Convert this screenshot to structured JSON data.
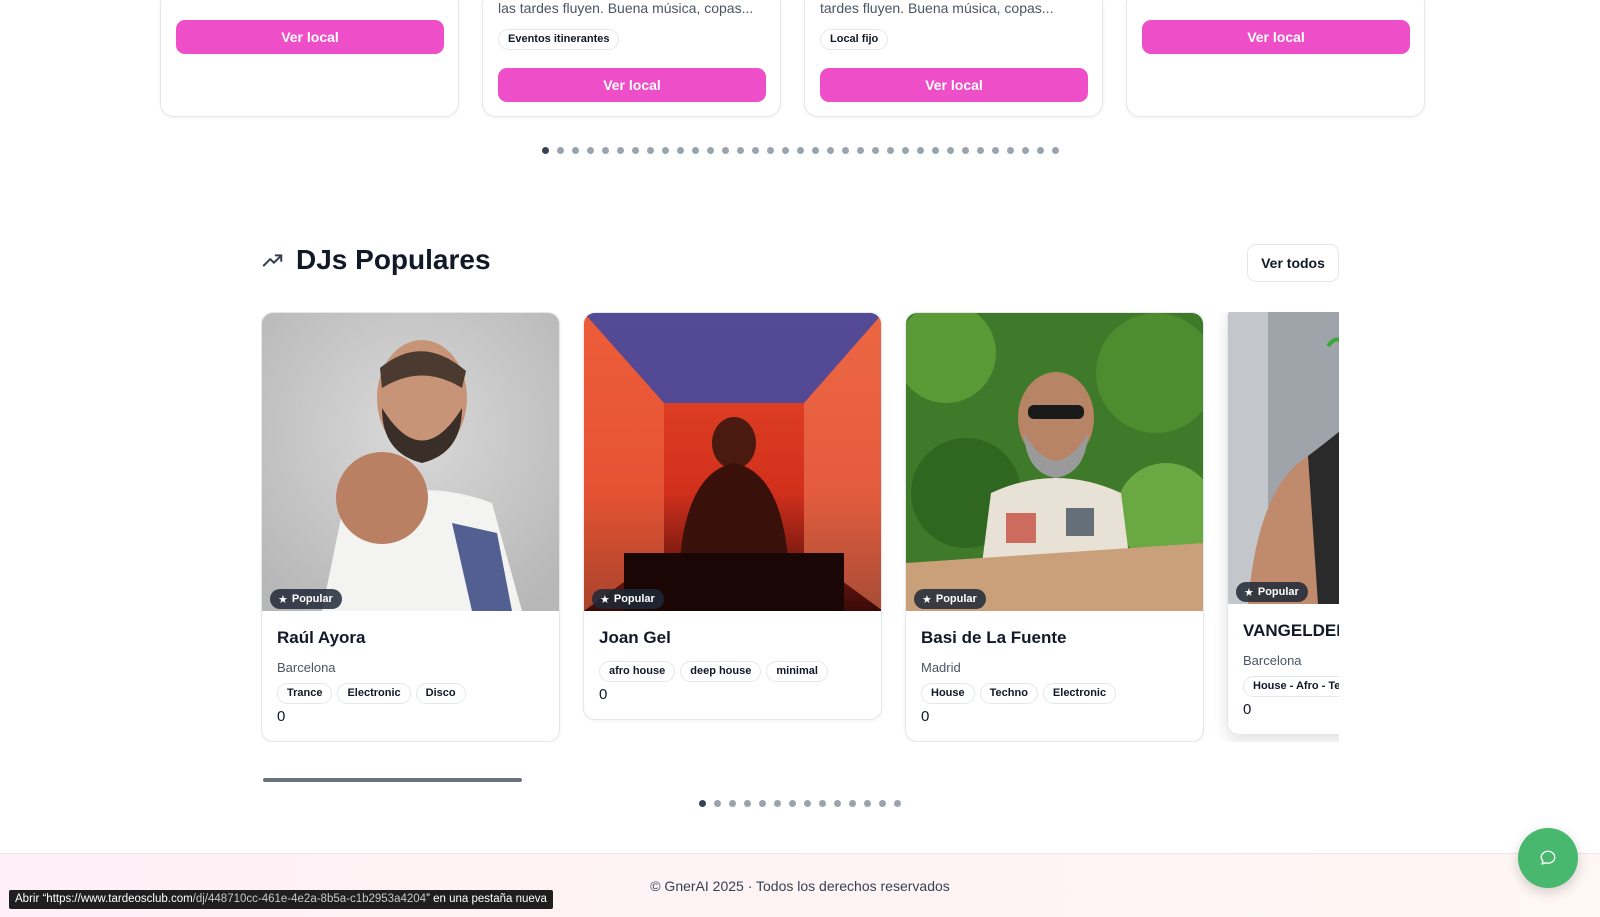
{
  "venues": {
    "cards": [
      {
        "description": "",
        "tag": "",
        "button_label": "Ver local"
      },
      {
        "description": "las tardes fluyen. Buena música, copas...",
        "tag": "Eventos itinerantes",
        "button_label": "Ver local"
      },
      {
        "description": "tardes fluyen. Buena música, copas...",
        "tag": "Local fijo",
        "button_label": "Ver local"
      },
      {
        "description": "",
        "tag": "",
        "button_label": "Ver local"
      }
    ],
    "pagination": {
      "total": 35,
      "active": 0
    }
  },
  "djs_section": {
    "title": "DJs Populares",
    "view_all_label": "Ver todos",
    "cards": [
      {
        "name": "Raúl Ayora",
        "city": "Barcelona",
        "badge": "Popular",
        "genres": [
          "Trance",
          "Electronic",
          "Disco"
        ],
        "count": "0"
      },
      {
        "name": "Joan Gel",
        "city": "",
        "badge": "Popular",
        "genres": [
          "afro house",
          "deep house",
          "minimal"
        ],
        "count": "0"
      },
      {
        "name": "Basi de La Fuente",
        "city": "Madrid",
        "badge": "Popular",
        "genres": [
          "House",
          "Techno",
          "Electronic"
        ],
        "count": "0"
      },
      {
        "name": "VANGELDER",
        "city": "Barcelona",
        "badge": "Popular",
        "genres": [
          "House - Afro - Tech"
        ],
        "count": "0"
      }
    ],
    "pagination": {
      "total": 14,
      "active": 0
    },
    "scroll_progress": 0.25
  },
  "footer": {
    "text": "© GnerAI 2025 · Todos los derechos reservados"
  },
  "status_bar": {
    "prefix": "Abrir “https://www.tardeosclub.com",
    "path": "/dj/448710cc-461e-4e2a-8b5a-c1b2953a4204",
    "suffix": "” en una pestaña nueva"
  },
  "colors": {
    "accent_pink": "#ee4ec8",
    "chat_green": "#47b86d"
  },
  "icons": {
    "section": "trending-up-icon",
    "badge": "star-icon",
    "chat": "chat-bubble-icon"
  }
}
